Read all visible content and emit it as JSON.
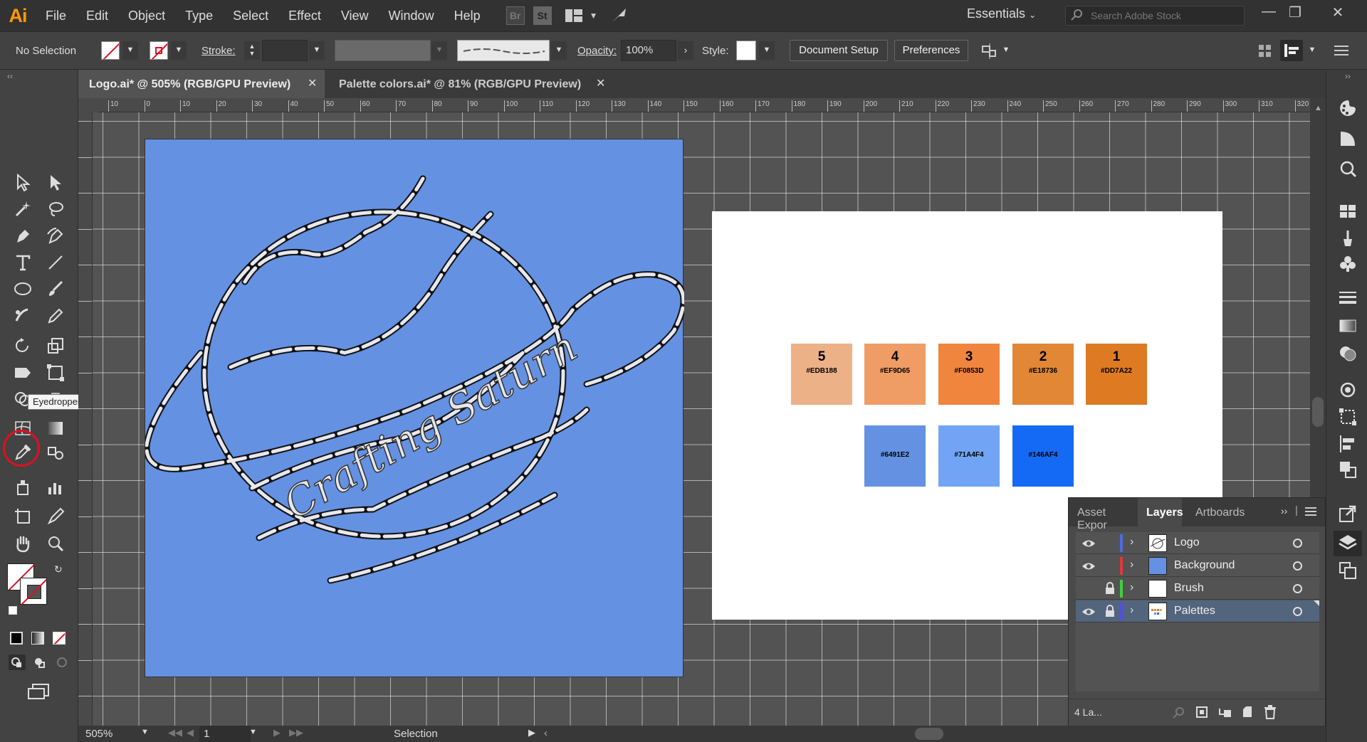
{
  "app": {
    "logo": "Ai"
  },
  "menu": [
    "File",
    "Edit",
    "Object",
    "Type",
    "Select",
    "Effect",
    "View",
    "Window",
    "Help"
  ],
  "menubar_icons": {
    "bridge": "Br",
    "stock": "St"
  },
  "workspace": "Essentials",
  "stock_search": {
    "placeholder": "Search Adobe Stock"
  },
  "control": {
    "selection": "No Selection",
    "stroke_label": "Stroke:",
    "opacity_label": "Opacity:",
    "opacity_value": "100%",
    "style_label": "Style:",
    "document_setup": "Document Setup",
    "preferences": "Preferences"
  },
  "tabs": [
    {
      "label": "Logo.ai* @ 505% (RGB/GPU Preview)",
      "active": true
    },
    {
      "label": "Palette colors.ai* @ 81% (RGB/GPU Preview)",
      "active": false
    }
  ],
  "tooltip": "Eyedropper Tool (I)",
  "ruler": {
    "h_ticks": [
      "10",
      "0",
      "10",
      "20",
      "30",
      "40",
      "50",
      "60",
      "70",
      "80",
      "90",
      "100",
      "110",
      "120",
      "130",
      "140",
      "150",
      "160",
      "170",
      "180",
      "190",
      "200",
      "210",
      "220",
      "230",
      "240",
      "250",
      "260",
      "270",
      "280",
      "290",
      "300",
      "310",
      "320"
    ]
  },
  "artwork": {
    "text": "Crafting Saturn",
    "background": "#6491E2"
  },
  "palette": {
    "row1": [
      {
        "num": "5",
        "hex": "#EDB188",
        "color": "#EDB188"
      },
      {
        "num": "4",
        "hex": "#EF9D65",
        "color": "#EF9D65"
      },
      {
        "num": "3",
        "hex": "#F0853D",
        "color": "#F0853D"
      },
      {
        "num": "2",
        "hex": "#E18736",
        "color": "#E18736"
      },
      {
        "num": "1",
        "hex": "#DD7A22",
        "color": "#DD7A22"
      }
    ],
    "row2": [
      {
        "hex": "#6491E2",
        "color": "#6491E2"
      },
      {
        "hex": "#71A4F4",
        "color": "#71A4F4"
      },
      {
        "hex": "#146AF4",
        "color": "#146AF4"
      }
    ]
  },
  "status": {
    "zoom": "505%",
    "artboard": "1",
    "tool": "Selection"
  },
  "layers_panel": {
    "tabs": [
      "Asset Expor",
      "Layers",
      "Artboards"
    ],
    "active_tab": "Layers",
    "layers": [
      {
        "name": "Logo",
        "color": "#4b6bdf",
        "visible": true,
        "locked": false,
        "selected": false
      },
      {
        "name": "Background",
        "color": "#e03a3a",
        "visible": true,
        "locked": false,
        "selected": false
      },
      {
        "name": "Brush",
        "color": "#3fcf3f",
        "visible": false,
        "locked": true,
        "selected": false
      },
      {
        "name": "Palettes",
        "color": "#5050e0",
        "visible": true,
        "locked": true,
        "selected": true
      }
    ],
    "count": "4 La..."
  }
}
